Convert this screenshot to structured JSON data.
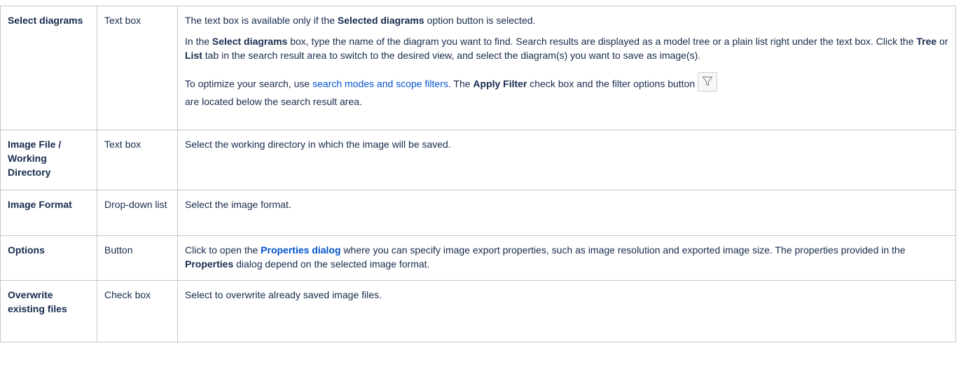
{
  "rows": [
    {
      "name": "Select diagrams",
      "type": "Text box",
      "desc1": "The text box is available only if the ",
      "desc1_b": "Selected diagrams",
      "desc1_c": " option button is selected.",
      "desc2_a": "In the ",
      "desc2_b": "Select diagrams",
      "desc2_c": " box, type the name of the diagram you want to find. Search results are displayed as a model tree or a plain list right under the text box. Click the ",
      "desc2_d": "Tree",
      "desc2_e": " or ",
      "desc2_f": "List",
      "desc2_g": " tab in the search result area to switch to the desired view, and select the diagram(s) you want to save as image(s).",
      "desc3_a": "To optimize your search, use ",
      "desc3_link": "search modes and scope filters",
      "desc3_b": ". The ",
      "desc3_c": "Apply Filter",
      "desc3_d": " check box and the filter options button",
      "desc3_e": "are located below the search result area."
    },
    {
      "name": "Image File / Working Directory",
      "type": "Text box",
      "desc": "Select the working directory in which the image will be saved."
    },
    {
      "name": "Image Format",
      "type": "Drop-down list",
      "desc": "Select the image format."
    },
    {
      "name": "Options",
      "type": "Button",
      "desc_a": "Click to open the ",
      "desc_link": "Properties dialog",
      "desc_b": " where you can specify image export properties, such as image resolution and exported image size. The properties provided in the ",
      "desc_c": "Properties",
      "desc_d": " dialog depend on the selected image format."
    },
    {
      "name": "Overwrite existing files",
      "type": "Check box",
      "desc": "Select to overwrite already saved image files."
    }
  ],
  "icons": {
    "filter": "filter-icon"
  },
  "colors": {
    "link": "#0052cc",
    "border": "#c1c7d0",
    "text": "#172b4d"
  }
}
